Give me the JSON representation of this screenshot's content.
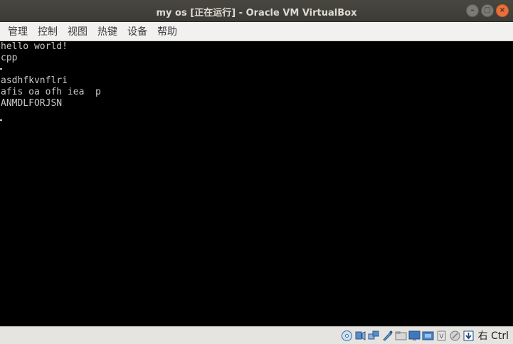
{
  "window": {
    "title": "my os [正在运行] - Oracle VM VirtualBox",
    "buttons": {
      "minimize": "–",
      "maximize": "□",
      "close": "×"
    }
  },
  "menu": {
    "items": [
      "管理",
      "控制",
      "视图",
      "热键",
      "设备",
      "帮助"
    ]
  },
  "console": {
    "lines": [
      "hello world!",
      "cpp",
      "",
      "asdhfkvnflri",
      "afis oa ofh iea  p",
      "ANMDLFORJSN"
    ]
  },
  "statusbar": {
    "icons": [
      "optical-drive-icon",
      "audio-icon",
      "network-icon",
      "usb-icon",
      "shared-folders-icon",
      "display-icon",
      "video-capture-icon",
      "cpu-virtualization-icon",
      "mouse-integration-icon",
      "host-key-arrow-icon"
    ],
    "host_key": "右 Ctrl"
  },
  "colors": {
    "titlebar": "#3c3b37",
    "close_button": "#e8703a",
    "menubar": "#f2f1f0",
    "console_bg": "#000000",
    "console_text": "#c8c8c8",
    "statusbar": "#e6e4e1"
  }
}
